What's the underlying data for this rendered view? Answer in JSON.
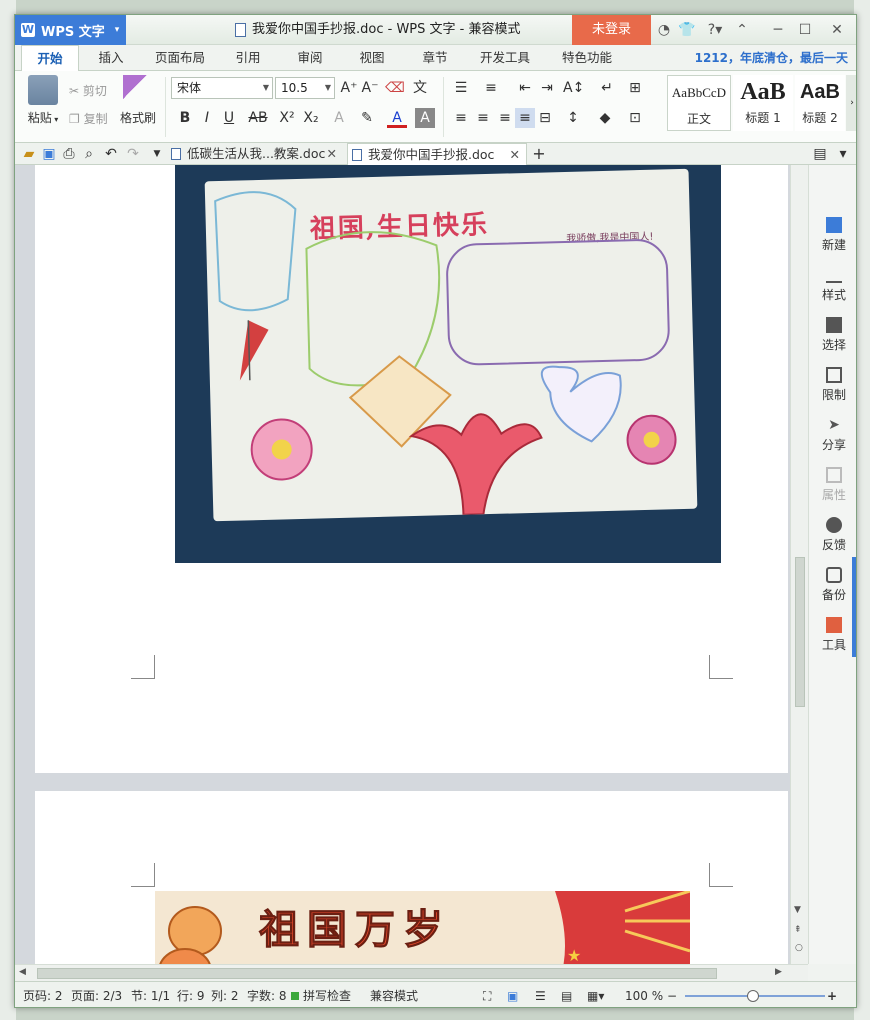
{
  "app": {
    "name": "WPS 文字",
    "window_title": "我爱你中国手抄报.doc - WPS 文字 - 兼容模式",
    "login_label": "未登录"
  },
  "tabs": [
    {
      "label": "开始",
      "active": true
    },
    {
      "label": "插入"
    },
    {
      "label": "页面布局"
    },
    {
      "label": "引用"
    },
    {
      "label": "审阅"
    },
    {
      "label": "视图"
    },
    {
      "label": "章节"
    },
    {
      "label": "开发工具"
    },
    {
      "label": "特色功能"
    }
  ],
  "promo": "1212，年底清仓，最后一天",
  "ribbon": {
    "paste": "粘贴",
    "cut": "剪切",
    "copy": "复制",
    "format_painter": "格式刷",
    "font_name": "宋体",
    "font_size": "10.5",
    "styles": [
      {
        "sample": "AaBbCcD",
        "name": "正文"
      },
      {
        "sample": "AaB",
        "name": "标题 1"
      },
      {
        "sample": "AaB",
        "name": "标题 2"
      }
    ]
  },
  "doc_tabs": [
    {
      "label": "低碳生活从我...教案.doc",
      "active": false
    },
    {
      "label": "我爱你中国手抄报.doc",
      "active": true
    }
  ],
  "document": {
    "poster1_title": "祖国,生日快乐",
    "poster1_subtitle": "我骄傲,我是中国人!",
    "poster2_title": "祖国万岁"
  },
  "sidebar": [
    {
      "label": "新建",
      "icon": "new-doc-icon"
    },
    {
      "label": "样式",
      "icon": "style-icon"
    },
    {
      "label": "选择",
      "icon": "select-icon"
    },
    {
      "label": "限制",
      "icon": "restrict-icon"
    },
    {
      "label": "分享",
      "icon": "share-icon"
    },
    {
      "label": "属性",
      "icon": "properties-icon",
      "disabled": true
    },
    {
      "label": "反馈",
      "icon": "feedback-icon"
    },
    {
      "label": "备份",
      "icon": "backup-icon"
    },
    {
      "label": "工具",
      "icon": "tools-icon"
    }
  ],
  "status": {
    "page_num": "页码: 2",
    "pages": "页面: 2/3",
    "section": "节: 1/1",
    "row": "行: 9",
    "col": "列: 2",
    "words": "字数: 8",
    "spell": "拼写检查",
    "mode": "兼容模式",
    "zoom": "100 %"
  },
  "colors": {
    "accent": "#3c7cd8",
    "login": "#e86a4a",
    "promo": "#2d6fcc"
  }
}
